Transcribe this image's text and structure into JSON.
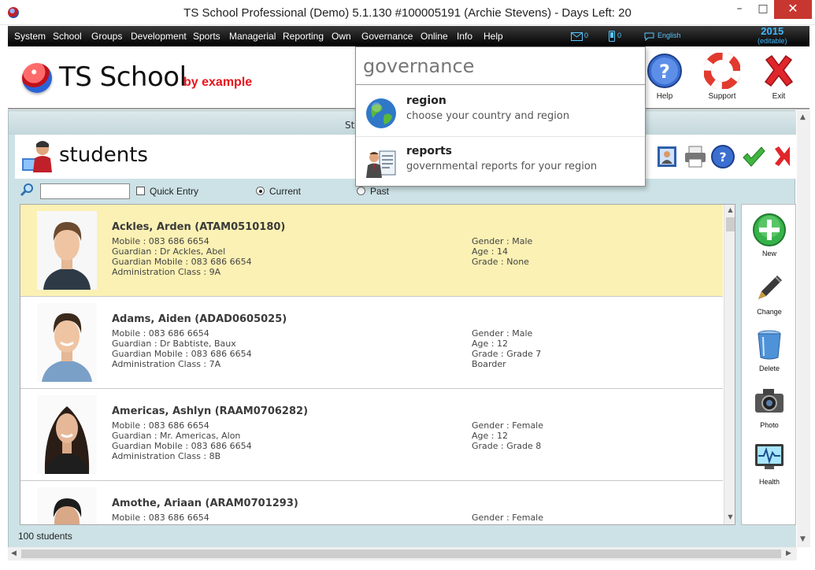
{
  "window": {
    "title": "TS School Professional (Demo) 5.1.130 #100005191 (Archie Stevens) - Days Left: 20",
    "minimize": "–",
    "maximize": "□",
    "close": "✕"
  },
  "menu": {
    "items": [
      "System",
      "School",
      "Groups",
      "Development",
      "Sports",
      "Managerial",
      "Reporting",
      "Own",
      "Governance",
      "Online",
      "Info",
      "Help"
    ],
    "messages_count": "0",
    "phone_count": "0",
    "language": "English",
    "year": "2015",
    "year_note": "(editable)"
  },
  "header": {
    "logo_text": "TS School",
    "logo_subtitle": "by example",
    "buttons": [
      "Help",
      "Support",
      "Exit"
    ]
  },
  "section": {
    "stub_text": "St",
    "title": "students"
  },
  "filters": {
    "search_value": "",
    "quick_entry_label": "Quick Entry",
    "current_label": "Current",
    "past_label": "Past",
    "selected": "Current"
  },
  "students": [
    {
      "name": "Ackles, Arden (ATAM0510180)",
      "left": [
        "Mobile : 083 686 6654",
        "Guardian : Dr Ackles, Abel",
        "Guardian Mobile : 083 686 6654",
        "Administration Class : 9A"
      ],
      "right": [
        "Gender : Male",
        "Age : 14",
        "Grade : None"
      ],
      "selected": true
    },
    {
      "name": "Adams, Aiden (ADAD0605025)",
      "left": [
        "Mobile : 083 686 6654",
        "Guardian : Dr Babtiste, Baux",
        "Guardian Mobile : 083 686 6654",
        "Administration Class : 7A"
      ],
      "right": [
        "Gender : Male",
        "Age : 12",
        "Grade : Grade 7",
        "Boarder"
      ],
      "selected": false
    },
    {
      "name": "Americas, Ashlyn (RAAM0706282)",
      "left": [
        "Mobile : 083 686 6654",
        "Guardian : Mr. Americas, Alon",
        "Guardian Mobile : 083 686 6654",
        "Administration Class : 8B"
      ],
      "right": [
        "Gender : Female",
        "Age : 12",
        "Grade : Grade 8"
      ],
      "selected": false
    },
    {
      "name": "Amothe, Ariaan (ARAM0701293)",
      "left": [
        "Mobile : 083 686 6654"
      ],
      "right": [
        "Gender : Female"
      ],
      "selected": false
    }
  ],
  "actions": [
    "New",
    "Change",
    "Delete",
    "Photo",
    "Health"
  ],
  "status": {
    "count_text": "100 students"
  },
  "dropdown": {
    "title": "governance",
    "items": [
      {
        "title": "region",
        "desc": "choose your country and region",
        "icon": "globe-icon"
      },
      {
        "title": "reports",
        "desc": "governmental reports for your region",
        "icon": "reports-icon"
      }
    ]
  },
  "colors": {
    "selected_row": "#fbf1b4",
    "frame_bg": "#cde2e6",
    "logo_sub": "#e8141c",
    "menu_accent": "#59c6ff",
    "close_btn": "#c7372f"
  }
}
